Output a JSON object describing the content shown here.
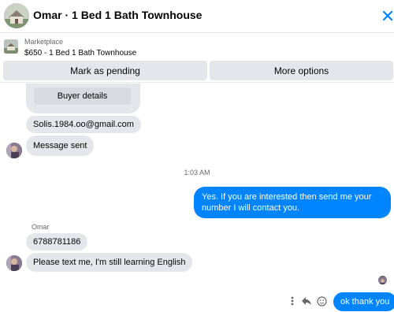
{
  "header": {
    "title": "Omar · 1 Bed 1 Bath Townhouse",
    "close_icon": "close-icon",
    "accent": "#0084ff"
  },
  "listing": {
    "label": "Marketplace",
    "title": "$650 - 1 Bed 1 Bath Townhouse"
  },
  "actions": {
    "pending_label": "Mark as pending",
    "options_label": "More options"
  },
  "messages": {
    "buyer_details_label": "Buyer details",
    "email": "Solis.1984.oo@gmail.com",
    "message_sent": "Message sent",
    "timestamp": "1:03 AM",
    "outgoing_reply": "Yes. If you are interested then send me your number I will contact you.",
    "sender_name": "Omar",
    "phone": "6788781186",
    "text_me": "Please text me, I'm still learning English",
    "last_outgoing": "ok thank you"
  },
  "toolbar": {
    "icons": [
      "more-vertical-icon",
      "reply-icon",
      "emoji-icon"
    ]
  },
  "colors": {
    "incoming_bubble": "#e4e6eb",
    "outgoing_bubble": "#0084ff"
  }
}
